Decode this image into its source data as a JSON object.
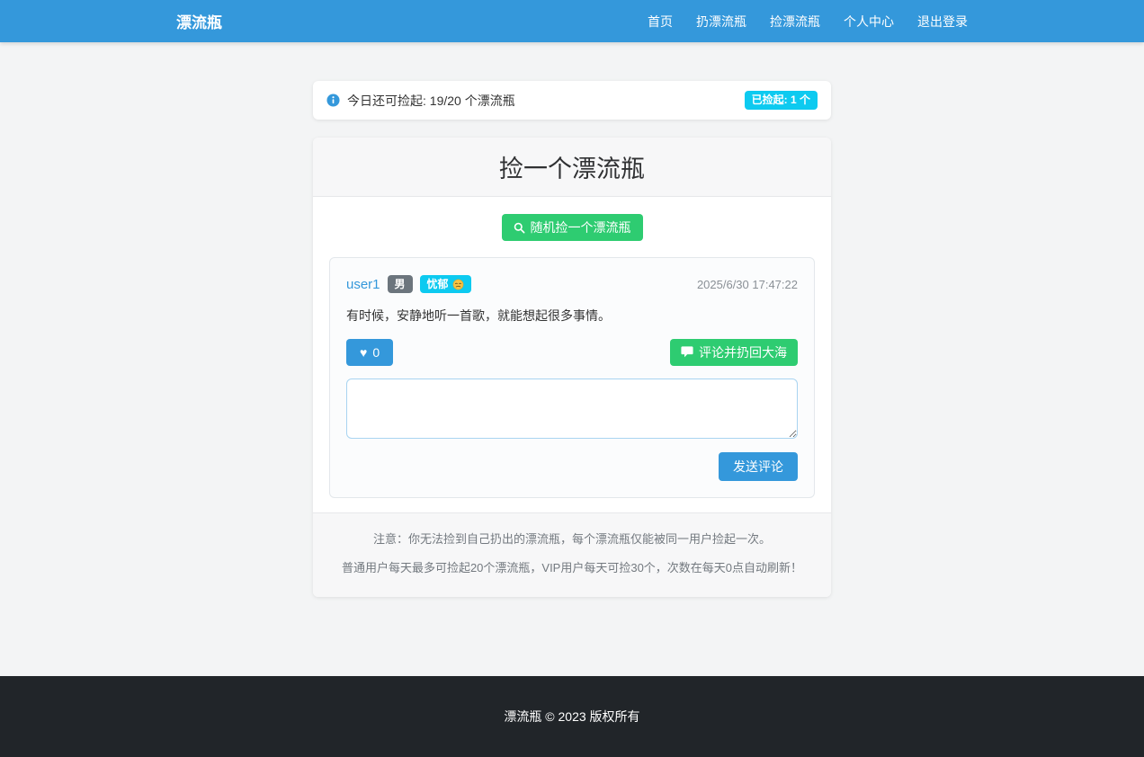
{
  "navbar": {
    "brand": "漂流瓶",
    "items": [
      {
        "label": "首页"
      },
      {
        "label": "扔漂流瓶"
      },
      {
        "label": "捡漂流瓶"
      },
      {
        "label": "个人中心"
      },
      {
        "label": "退出登录"
      }
    ]
  },
  "quota": {
    "info_text": "今日还可捡起: 19/20 个漂流瓶",
    "picked_badge": "已捡起: 1 个"
  },
  "pick_card": {
    "title": "捡一个漂流瓶",
    "random_button": "随机捡一个漂流瓶",
    "bottle": {
      "username": "user1",
      "gender_badge": "男",
      "mood_badge": "忧郁",
      "timestamp": "2025/6/30 17:47:22",
      "message": "有时候，安静地听一首歌，就能想起很多事情。",
      "like_count": "0",
      "comment_button": "评论并扔回大海",
      "send_button": "发送评论",
      "comment_value": ""
    },
    "notes": [
      "注意：你无法捡到自己扔出的漂流瓶，每个漂流瓶仅能被同一用户捡起一次。",
      "普通用户每天最多可捡起20个漂流瓶，VIP用户每天可捡30个，次数在每天0点自动刷新！"
    ]
  },
  "footer": {
    "copyright": "漂流瓶 © 2023 版权所有"
  },
  "icons": {
    "info": "info-circle",
    "random": "search",
    "like": "heart",
    "heart_glyph": "♥",
    "comment": "speech-bubble",
    "mood": "pensive-face"
  },
  "colors": {
    "primary_blue": "#3498db",
    "success_green": "#2ecc71",
    "info_cyan": "#0dcaf0",
    "secondary_gray": "#6c757d",
    "footer_dark": "#212529",
    "page_bg": "#f3f4f5"
  }
}
